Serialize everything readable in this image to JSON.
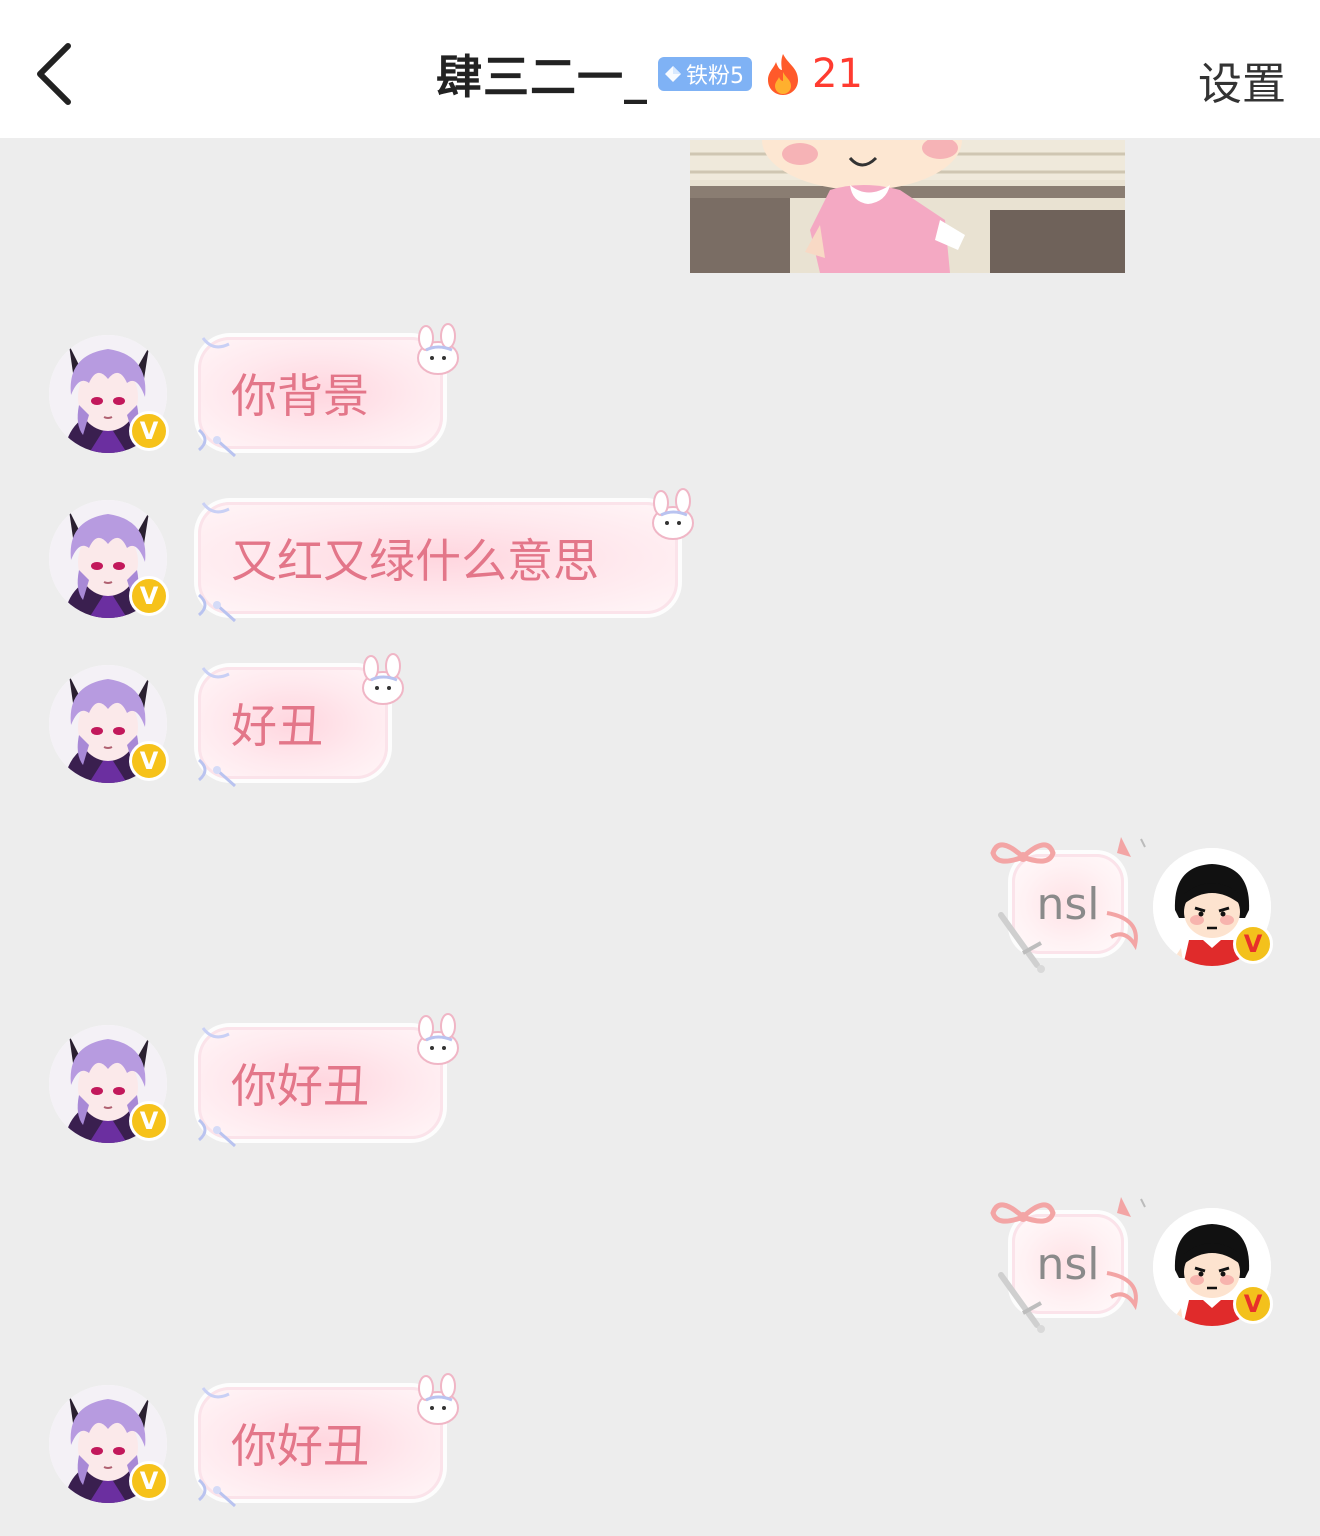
{
  "header": {
    "title": "肆三二一_",
    "fan_badge": "铁粉5",
    "fire_count": "21",
    "settings_label": "设置"
  },
  "messages": [
    {
      "side": "left",
      "text": "你背景"
    },
    {
      "side": "left",
      "text": "又红又绿什么意思"
    },
    {
      "side": "left",
      "text": "好丑"
    },
    {
      "side": "right",
      "text": "nsl"
    },
    {
      "side": "left",
      "text": "你好丑"
    },
    {
      "side": "right",
      "text": "nsl"
    },
    {
      "side": "left",
      "text": "你好丑"
    }
  ],
  "badges": {
    "verified_letter": "V"
  },
  "colors": {
    "header_bg": "#ffffff",
    "page_bg": "#ededed",
    "fan_badge_bg": "#7fb2f5",
    "fire_count": "#ff3b30",
    "bubble_text_left": "#e37689",
    "bubble_text_right": "#8a8a8a",
    "verified_badge": "#f6c21a"
  },
  "icons": {
    "back": "chevron-left-icon",
    "fan_badge": "diamond-icon",
    "fire": "fire-icon",
    "verified": "verified-v-icon"
  }
}
